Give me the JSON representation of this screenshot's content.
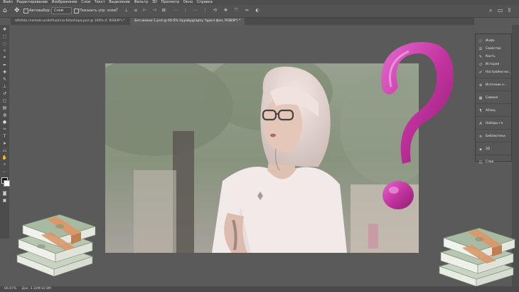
{
  "menu": [
    "Файл",
    "Редактирование",
    "Изображение",
    "Слои",
    "Текст",
    "Выделение",
    "Фильтр",
    "3D",
    "Просмотр",
    "Окно",
    "Справка"
  ],
  "options": {
    "auto_select_label": "Автовыбор:",
    "auto_select_value": "Слой",
    "show_controls_label": "Показать упр. элем."
  },
  "tabs": [
    "alfafoto markets-undefined-na-fotoshopa.psd @ 100% (f, RGB/8*) *",
    "Без имени-1.psd @ 66.6% (typobygraphy Чуркл фон, RGB/8*) *"
  ],
  "panel_items": [
    {
      "icon": "info-icon",
      "glyph": "ⓘ",
      "label": "Инфо"
    },
    {
      "icon": "properties-icon",
      "glyph": "☰",
      "label": "Свойства"
    },
    {
      "icon": "brush-icon",
      "glyph": "✎",
      "label": "Кисть"
    },
    {
      "icon": "history-icon",
      "glyph": "↺",
      "label": "История"
    },
    {
      "icon": "brush-settings-icon",
      "glyph": "✐",
      "label": "Настройки ки..."
    },
    {
      "icon": "clone-source-icon",
      "glyph": "⊕",
      "label": "Источник к..."
    },
    {
      "icon": "swatches-icon",
      "glyph": "▦",
      "label": "Символ"
    },
    {
      "icon": "paragraph-icon",
      "glyph": "¶",
      "label": "Абзац"
    },
    {
      "icon": "glyphs-icon",
      "glyph": "A",
      "label": "Наборы гл"
    },
    {
      "icon": "paragraph-styles-icon",
      "glyph": "≡",
      "label": "Библиотеки"
    },
    {
      "icon": "3d-icon",
      "glyph": "◈",
      "label": "3D"
    },
    {
      "icon": "layers-icon",
      "glyph": "◫",
      "label": "Слои"
    }
  ],
  "status": {
    "zoom": "66.67%",
    "doc": "Док: 3.32M/32.8M"
  },
  "colors": {
    "accent_magenta": "#c2339e",
    "money_green": "#8fa88a",
    "band_orange": "#d8986a"
  }
}
